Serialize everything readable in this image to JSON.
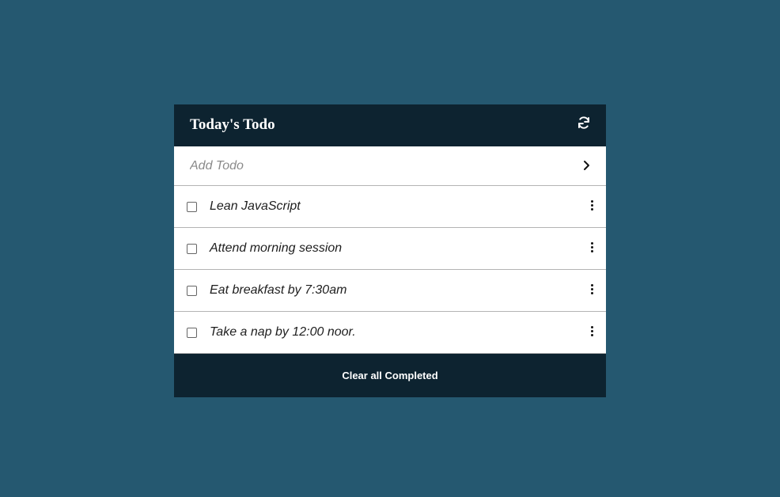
{
  "app": {
    "title": "Today's Todo"
  },
  "add_todo": {
    "placeholder": "Add Todo",
    "value": ""
  },
  "todos": [
    {
      "text": "Lean JavaScript",
      "completed": false
    },
    {
      "text": "Attend morning session",
      "completed": false
    },
    {
      "text": "Eat breakfast by 7:30am",
      "completed": false
    },
    {
      "text": "Take a nap by 12:00 noor.",
      "completed": false
    }
  ],
  "footer": {
    "clear_label": "Clear all Completed"
  },
  "icons": {
    "refresh": "refresh-icon",
    "add": "chevron-right-icon",
    "more": "more-vertical-icon"
  },
  "colors": {
    "background": "#255870",
    "header": "#0d2330",
    "footer": "#0d2330",
    "card": "#ffffff",
    "divider": "#b4b4b4"
  }
}
